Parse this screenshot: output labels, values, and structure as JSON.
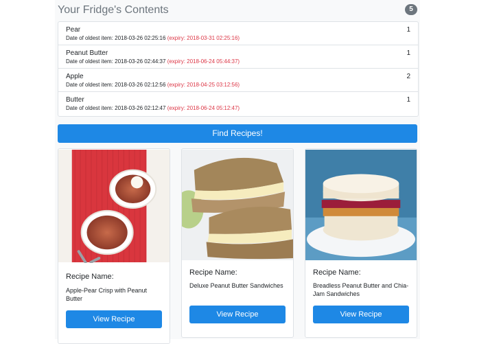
{
  "header": {
    "title": "Your Fridge's Contents",
    "count_badge": "5"
  },
  "fridge_items": [
    {
      "name": "Pear",
      "oldest_label": "Date of oldest item:",
      "oldest_date": "2018-03-26 02:25:16",
      "expiry": "(expiry: 2018-03-31 02:25:16)",
      "count": "1"
    },
    {
      "name": "Peanut Butter",
      "oldest_label": "Date of oldest item:",
      "oldest_date": "2018-03-26 02:44:37",
      "expiry": "(expiry: 2018-06-24 05:44:37)",
      "count": "1"
    },
    {
      "name": "Apple",
      "oldest_label": "Date of oldest item:",
      "oldest_date": "2018-03-26 02:12:56",
      "expiry": "(expiry: 2018-04-25 03:12:56)",
      "count": "2"
    },
    {
      "name": "Butter",
      "oldest_label": "Date of oldest item:",
      "oldest_date": "2018-03-26 02:12:47",
      "expiry": "(expiry: 2018-06-24 05:12:47)",
      "count": "1"
    }
  ],
  "find_button": {
    "label": "Find Recipes!"
  },
  "recipes": [
    {
      "label": "Recipe Name:",
      "name": "Apple-Pear Crisp with Peanut Butter",
      "button": "View Recipe",
      "image": "apple-pear-crisp-photo"
    },
    {
      "label": "Recipe Name:",
      "name": "Deluxe Peanut Butter Sandwiches",
      "button": "View Recipe",
      "image": "sandwich-photo"
    },
    {
      "label": "Recipe Name:",
      "name": "Breadless Peanut Butter and Chia-Jam Sandwiches",
      "button": "View Recipe",
      "image": "rice-cake-sandwich-photo"
    }
  ],
  "colors": {
    "primary": "#1e88e5",
    "expiry": "#dc3545",
    "muted": "#6c757d"
  }
}
